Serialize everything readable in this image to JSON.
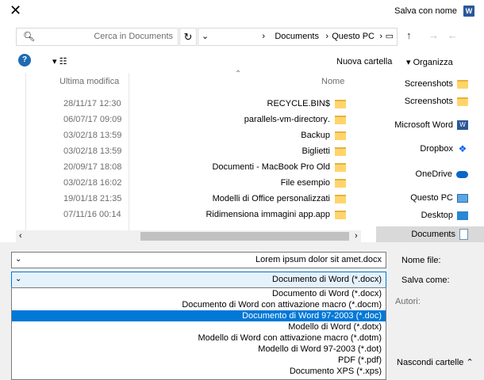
{
  "window": {
    "title": "Salva con nome",
    "app_icon": "W"
  },
  "address": {
    "path": [
      "Documents",
      "Questo PC"
    ],
    "search_placeholder": "Cerca in Documents"
  },
  "toolbar": {
    "organize": "Organizza",
    "new_folder": "Nuova cartella"
  },
  "columns": {
    "name": "Nome",
    "modified": "Ultima modifica"
  },
  "files": [
    {
      "name": "$RECYCLE.BIN",
      "date": "28/11/17 12:30"
    },
    {
      "name": ".parallels-vm-directory",
      "date": "06/07/17 09:09"
    },
    {
      "name": "Backup",
      "date": "03/02/18 13:59"
    },
    {
      "name": "Biglietti",
      "date": "03/02/18 13:59"
    },
    {
      "name": "Documenti - MacBook Pro Old",
      "date": "20/09/17 18:08"
    },
    {
      "name": "File esempio",
      "date": "03/02/18 16:02"
    },
    {
      "name": "Modelli di Office personalizzati",
      "date": "19/01/18 21:35"
    },
    {
      "name": "Ridimensiona immagini app.app",
      "date": "07/11/16 00:14"
    }
  ],
  "nav": [
    {
      "label": "Screenshots",
      "icon": "folder-icon"
    },
    {
      "label": "Screenshots",
      "icon": "folder-icon"
    },
    {
      "label": "Microsoft Word",
      "icon": "word-folder-icon"
    },
    {
      "label": "Dropbox",
      "icon": "dropbox-icon"
    },
    {
      "label": "OneDrive",
      "icon": "onedrive-icon"
    },
    {
      "label": "Questo PC",
      "icon": "pc-icon"
    },
    {
      "label": "Desktop",
      "icon": "desktop-icon"
    },
    {
      "label": "Documents",
      "icon": "documents-icon"
    }
  ],
  "form": {
    "filename_label": "Nome file:",
    "filename_value": "Lorem ipsum dolor sit amet.docx",
    "type_label": "Salva come:",
    "type_value": "Documento di Word (*.docx)",
    "authors_label": "Autori:",
    "hide_folders": "Nascondi cartelle"
  },
  "type_options": [
    "Documento di Word (*.docx)",
    "Documento di Word con attivazione macro (*.docm)",
    "Documento di Word 97-2003 (*.doc)",
    "Modello di Word (*.dotx)",
    "Modello di Word con attivazione macro (*.dotm)",
    "Modello di Word 97-2003 (*.dot)",
    "PDF (*.pdf)",
    "Documento XPS (*.xps)"
  ],
  "selected_option_index": 2,
  "colors": {
    "accent": "#0078d7",
    "selection": "#d9d9d9",
    "folder": "#ffd56b"
  }
}
